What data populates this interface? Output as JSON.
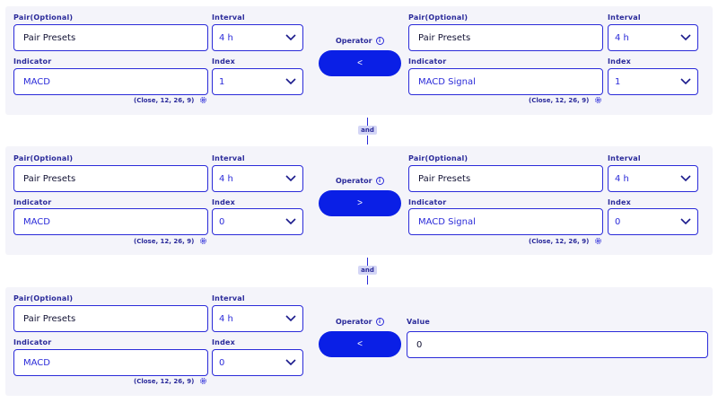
{
  "blocks": [
    {
      "left": {
        "pair_label": "Pair(Optional)",
        "pair_value": "Pair Presets",
        "interval_label": "Interval",
        "interval_value": "4 h",
        "indicator_label": "Indicator",
        "indicator_value": "MACD",
        "index_label": "Index",
        "index_value": "1",
        "params": "(Close, 12, 26, 9)"
      },
      "operator_label": "Operator",
      "operator_value": "<",
      "right": {
        "pair_label": "Pair(Optional)",
        "pair_value": "Pair Presets",
        "interval_label": "Interval",
        "interval_value": "4 h",
        "indicator_label": "Indicator",
        "indicator_value": "MACD Signal",
        "index_label": "Index",
        "index_value": "1",
        "params": "(Close, 12, 26, 9)"
      }
    },
    {
      "left": {
        "pair_label": "Pair(Optional)",
        "pair_value": "Pair Presets",
        "interval_label": "Interval",
        "interval_value": "4 h",
        "indicator_label": "Indicator",
        "indicator_value": "MACD",
        "index_label": "Index",
        "index_value": "0",
        "params": "(Close, 12, 26, 9)"
      },
      "operator_label": "Operator",
      "operator_value": ">",
      "right": {
        "pair_label": "Pair(Optional)",
        "pair_value": "Pair Presets",
        "interval_label": "Interval",
        "interval_value": "4 h",
        "indicator_label": "Indicator",
        "indicator_value": "MACD Signal",
        "index_label": "Index",
        "index_value": "0",
        "params": "(Close, 12, 26, 9)"
      }
    },
    {
      "left": {
        "pair_label": "Pair(Optional)",
        "pair_value": "Pair Presets",
        "interval_label": "Interval",
        "interval_value": "4 h",
        "indicator_label": "Indicator",
        "indicator_value": "MACD",
        "index_label": "Index",
        "index_value": "0",
        "params": "(Close, 12, 26, 9)"
      },
      "operator_label": "Operator",
      "operator_value": "<",
      "right_value": {
        "label": "Value",
        "value": "0"
      }
    }
  ],
  "connectors": [
    "and",
    "and"
  ],
  "icons": {
    "chevron": "chevron-down-icon",
    "gear": "gear-icon",
    "info": "info-icon"
  },
  "colors": {
    "accent": "#0a1fe6",
    "border": "#2b2bd9",
    "panel": "#f4f4fa",
    "tag": "#d4d6f6"
  }
}
